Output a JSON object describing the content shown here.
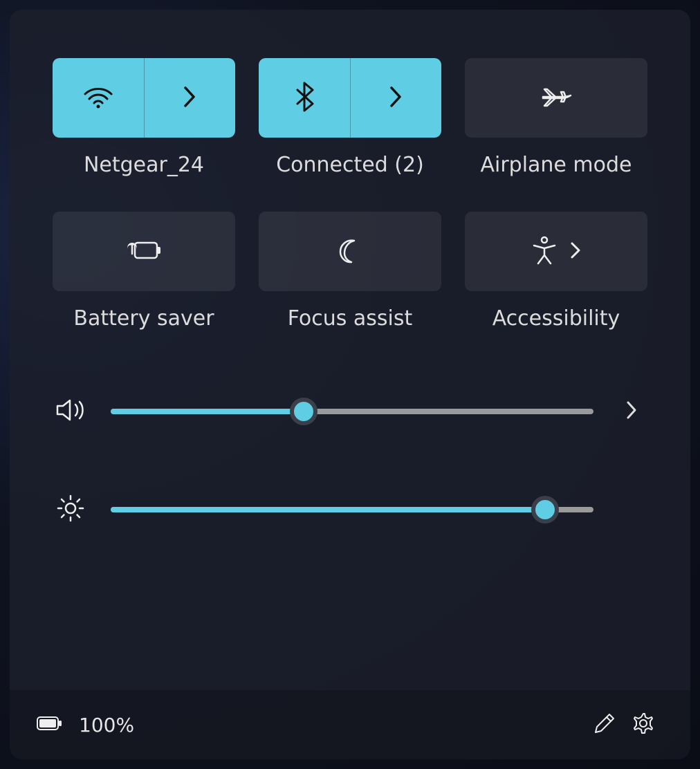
{
  "colors": {
    "accent": "#5fcde4"
  },
  "tiles": {
    "wifi": {
      "label": "Netgear_24",
      "active": true
    },
    "bluetooth": {
      "label": "Connected (2)",
      "active": true
    },
    "airplane": {
      "label": "Airplane mode",
      "active": false
    },
    "battery_saver": {
      "label": "Battery saver",
      "active": false
    },
    "focus_assist": {
      "label": "Focus assist",
      "active": false
    },
    "accessibility": {
      "label": "Accessibility",
      "active": false
    }
  },
  "sliders": {
    "volume": {
      "value": 40
    },
    "brightness": {
      "value": 90
    }
  },
  "footer": {
    "battery_percent": "100%"
  }
}
